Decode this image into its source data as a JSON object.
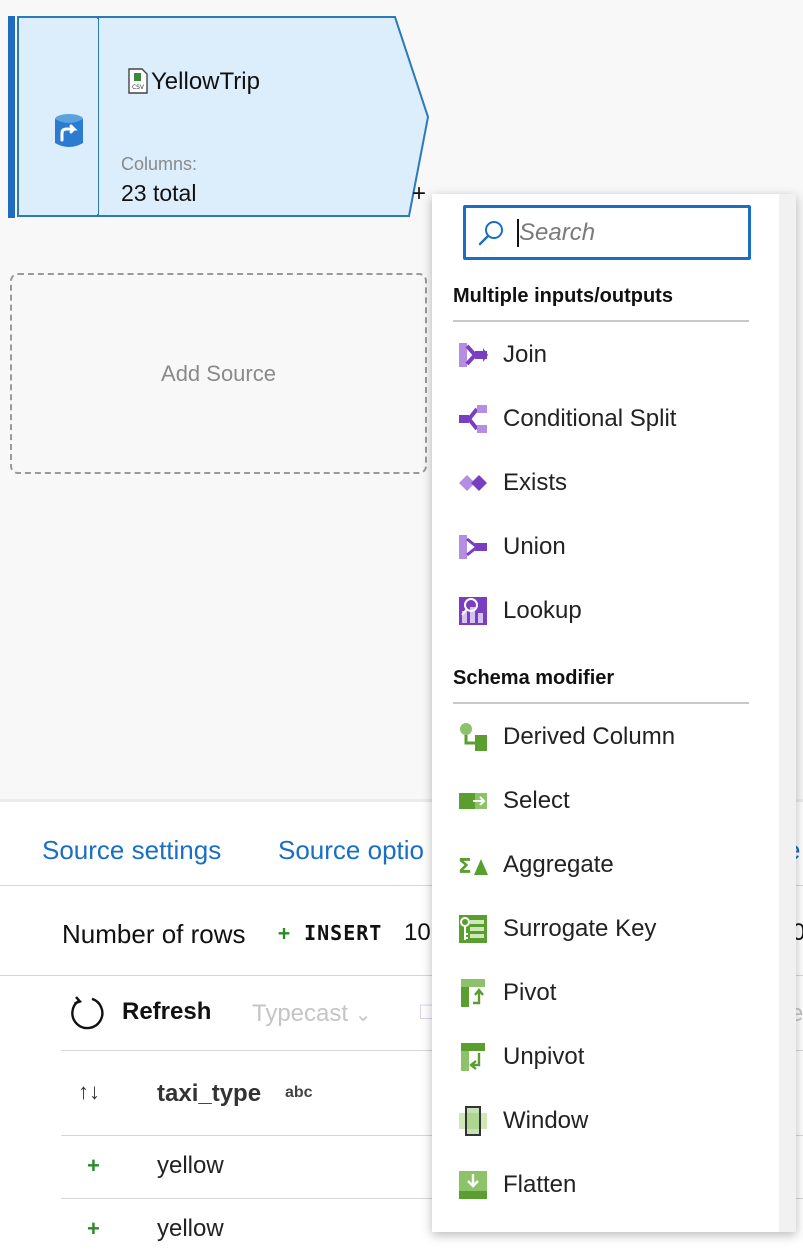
{
  "canvas": {
    "source_node": {
      "title": "YellowTrip",
      "columns_label": "Columns:",
      "columns_value": "23 total",
      "plus": "+"
    },
    "add_source_label": "Add Source"
  },
  "panel": {
    "tabs": [
      "Source settings",
      "Source optio",
      "e"
    ],
    "rows_label": "Number of rows",
    "insert_plus": "+",
    "insert_label": "INSERT",
    "rows_value": "10",
    "rows_value_right": "0",
    "refresh_label": "Refresh",
    "typecast_label": "Typecast",
    "right_clip_text": "e",
    "sort_icon": "↑↓",
    "column_header": "taxi_type",
    "column_type": "abc",
    "rows": [
      {
        "mark": "+",
        "value": "yellow"
      },
      {
        "mark": "+",
        "value": "yellow"
      }
    ]
  },
  "menu": {
    "search_placeholder": "Search",
    "sections": [
      {
        "title": "Multiple inputs/outputs",
        "items": [
          {
            "label": "Join",
            "icon": "join-icon"
          },
          {
            "label": "Conditional Split",
            "icon": "conditional-split-icon"
          },
          {
            "label": "Exists",
            "icon": "exists-icon"
          },
          {
            "label": "Union",
            "icon": "union-icon"
          },
          {
            "label": "Lookup",
            "icon": "lookup-icon"
          }
        ]
      },
      {
        "title": "Schema modifier",
        "items": [
          {
            "label": "Derived Column",
            "icon": "derived-column-icon"
          },
          {
            "label": "Select",
            "icon": "select-icon"
          },
          {
            "label": "Aggregate",
            "icon": "aggregate-icon"
          },
          {
            "label": "Surrogate Key",
            "icon": "surrogate-key-icon"
          },
          {
            "label": "Pivot",
            "icon": "pivot-icon"
          },
          {
            "label": "Unpivot",
            "icon": "unpivot-icon"
          },
          {
            "label": "Window",
            "icon": "window-icon"
          },
          {
            "label": "Flatten",
            "icon": "flatten-icon"
          }
        ]
      }
    ]
  },
  "colors": {
    "accent": "#1a6fc4",
    "node_fill": "#dcedfb",
    "node_border": "#2b7bb9",
    "purple_icon": "#7a3fc0",
    "green_icon": "#5a9e2f"
  }
}
